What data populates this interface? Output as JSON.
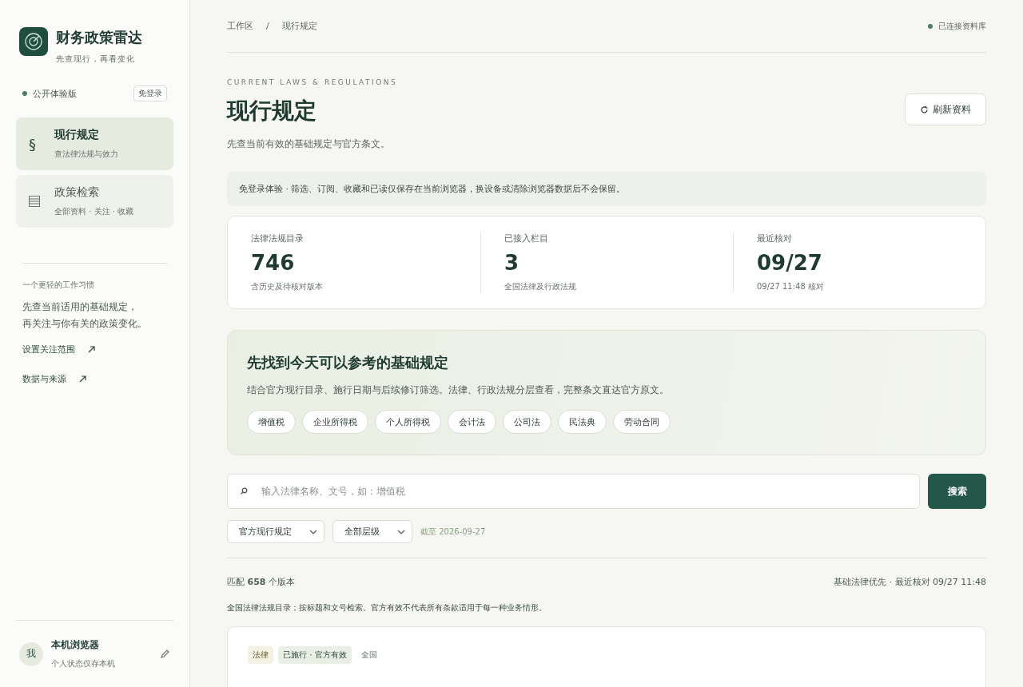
{
  "brand": {
    "name": "财务政策雷达",
    "tagline": "先查现行，再看变化"
  },
  "edition": {
    "label": "公开体验版",
    "badge": "免登录"
  },
  "nav": [
    {
      "kind": "section",
      "glyph": "§",
      "title": "现行规定",
      "subtitle": "查法律法规与效力",
      "selected": true
    },
    {
      "kind": "list",
      "title": "政策检索",
      "subtitle": "全部资料 · 关注 · 收藏",
      "selected": false
    }
  ],
  "habit": {
    "heading": "一个更轻的工作习惯",
    "lines": [
      "先查当前适用的基础规定，",
      "再关注与你有关的政策变化。"
    ]
  },
  "links": [
    "设置关注范围",
    "数据与来源"
  ],
  "user": {
    "avatar": "我",
    "name": "本机浏览器",
    "note": "个人状态仅存本机"
  },
  "breadcrumb": {
    "items": [
      "工作区",
      "现行规定"
    ],
    "separator": "/"
  },
  "status": "已连接资料库",
  "header": {
    "eyebrow": "CURRENT LAWS & REGULATIONS",
    "title": "现行规定",
    "subtitle": "先查当前有效的基础规定与官方条文。",
    "refresh": "刷新资料"
  },
  "notice": "免登录体验 · 筛选、订阅、收藏和已读仅保存在当前浏览器，换设备或清除浏览器数据后不会保留。",
  "stats": [
    {
      "label": "法律法规目录",
      "value": "746",
      "note": "含历史及待核对版本"
    },
    {
      "label": "已接入栏目",
      "value": "3",
      "note": "全国法律及行政法规"
    },
    {
      "label": "最近核对",
      "value": "09/27",
      "note": "09/27 11:48 核对"
    }
  ],
  "hero": {
    "title": "先找到今天可以参考的基础规定",
    "text": "结合官方现行目录、施行日期与后续修订筛选。法律、行政法规分层查看，完整条文直达官方原文。",
    "chips": [
      "增值税",
      "企业所得税",
      "个人所得税",
      "会计法",
      "公司法",
      "民法典",
      "劳动合同"
    ]
  },
  "search": {
    "placeholder": "输入法律名称、文号，如：增值税",
    "button": "搜索"
  },
  "filters": {
    "selects": [
      "官方现行规定",
      "全部层级"
    ],
    "date": "截至 2026-09-27"
  },
  "results": {
    "summary": "匹配 **658** 个版本",
    "meta": "基础法律优先 · 最近核对 09/27 11:48",
    "note": "全国法律法规目录；按标题和文号检索。官方有效不代表所有条款适用于每一种业务情形。"
  },
  "card": {
    "tags": [
      {
        "kind": "level",
        "label": "法律"
      },
      {
        "kind": "status",
        "label": "已施行 · 官方有效"
      },
      {
        "kind": "plain",
        "label": "全国"
      }
    ]
  }
}
